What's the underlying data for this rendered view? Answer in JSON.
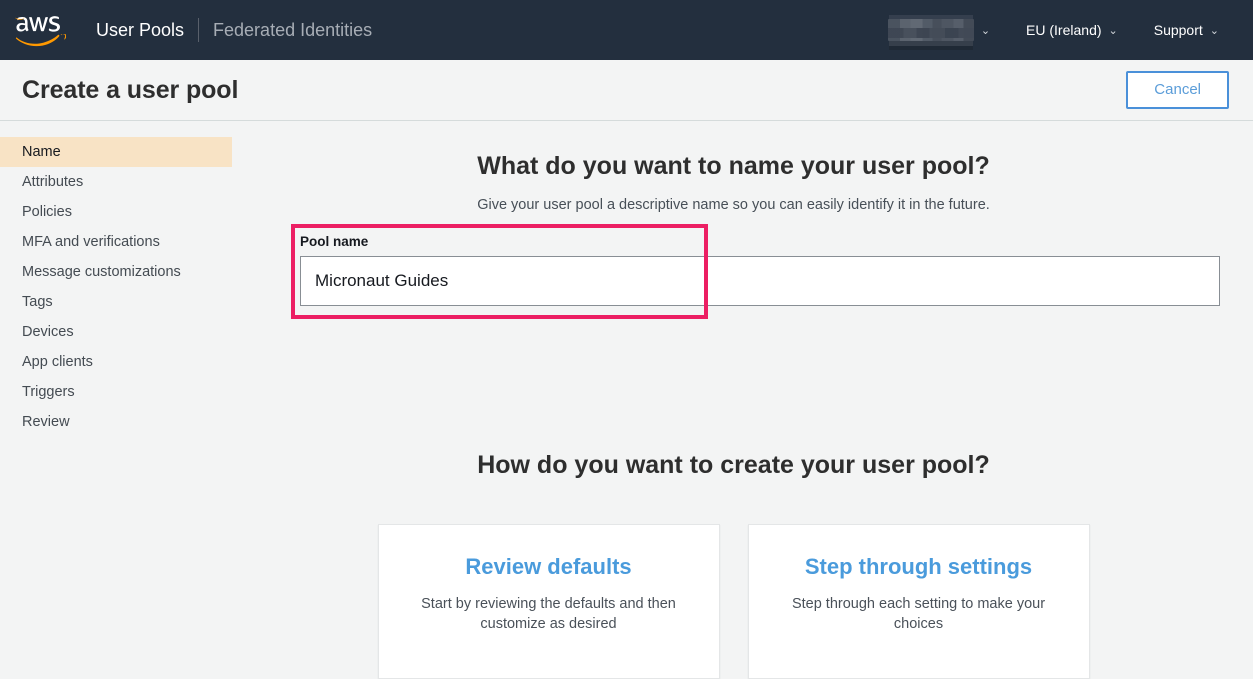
{
  "topnav": {
    "logo_alt": "aws-logo",
    "links": [
      {
        "label": "User Pools",
        "muted": false
      },
      {
        "label": "Federated Identities",
        "muted": true
      }
    ],
    "account": {
      "label": "",
      "redacted": true,
      "caret": "⌄"
    },
    "region": {
      "label": "EU (Ireland)",
      "caret": "⌄"
    },
    "support": {
      "label": "Support",
      "caret": "⌄"
    },
    "background": "#232f3e"
  },
  "titlebar": {
    "title": "Create a user pool",
    "cancel_label": "Cancel",
    "cancel_color": "#4a90d9"
  },
  "sidebar": {
    "items": [
      {
        "label": "Name",
        "active": true
      },
      {
        "label": "Attributes",
        "active": false
      },
      {
        "label": "Policies",
        "active": false
      },
      {
        "label": "MFA and verifications",
        "active": false
      },
      {
        "label": "Message customizations",
        "active": false
      },
      {
        "label": "Tags",
        "active": false
      },
      {
        "label": "Devices",
        "active": false
      },
      {
        "label": "App clients",
        "active": false
      },
      {
        "label": "Triggers",
        "active": false
      },
      {
        "label": "Review",
        "active": false
      }
    ],
    "active_background": "#f8e3c5"
  },
  "main": {
    "heading": "What do you want to name your user pool?",
    "subheading": "Give your user pool a descriptive name so you can easily identify it in the future.",
    "field": {
      "label": "Pool name",
      "value": "Micronaut Guides",
      "placeholder": ""
    },
    "annotation": {
      "color": "#ec1e63"
    },
    "second_heading": "How do you want to create your user pool?",
    "cards": [
      {
        "title": "Review defaults",
        "description": "Start by reviewing the defaults and then customize as desired"
      },
      {
        "title": "Step through settings",
        "description": "Step through each setting to make your choices"
      }
    ],
    "card_title_color": "#4a9bdc"
  }
}
